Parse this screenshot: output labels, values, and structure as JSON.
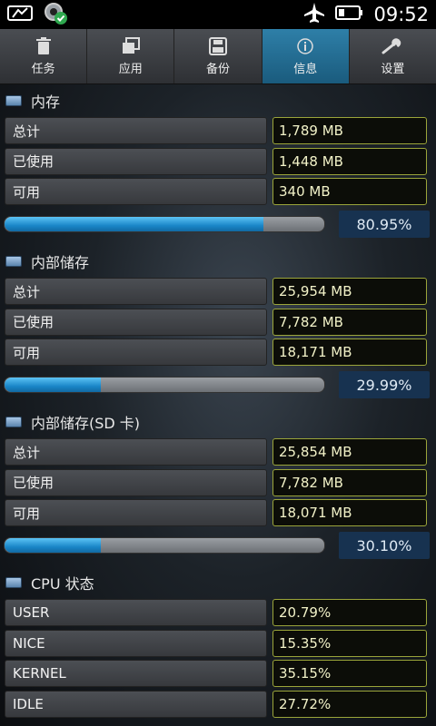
{
  "statusbar": {
    "time": "09:52",
    "icons": [
      "card-icon",
      "gear-check-icon",
      "airplane-icon",
      "battery-icon"
    ]
  },
  "tabs": [
    {
      "label": "任务",
      "icon": "trash-icon",
      "active": false
    },
    {
      "label": "应用",
      "icon": "apps-icon",
      "active": false
    },
    {
      "label": "备份",
      "icon": "save-icon",
      "active": false
    },
    {
      "label": "信息",
      "icon": "info-icon",
      "active": true
    },
    {
      "label": "设置",
      "icon": "wrench-icon",
      "active": false
    }
  ],
  "sections": [
    {
      "title": "内存",
      "rows": [
        {
          "label": "总计",
          "value": "1,789 MB"
        },
        {
          "label": "已使用",
          "value": "1,448 MB"
        },
        {
          "label": "可用",
          "value": "340 MB"
        }
      ],
      "percent": "80.95%",
      "progress": 0.8095
    },
    {
      "title": "内部储存",
      "rows": [
        {
          "label": "总计",
          "value": "25,954 MB"
        },
        {
          "label": "已使用",
          "value": "7,782 MB"
        },
        {
          "label": "可用",
          "value": "18,171 MB"
        }
      ],
      "percent": "29.99%",
      "progress": 0.2999
    },
    {
      "title": "内部储存(SD 卡)",
      "rows": [
        {
          "label": "总计",
          "value": "25,854 MB"
        },
        {
          "label": "已使用",
          "value": "7,782 MB"
        },
        {
          "label": "可用",
          "value": "18,071 MB"
        }
      ],
      "percent": "30.10%",
      "progress": 0.301
    }
  ],
  "cpu": {
    "title": "CPU 状态",
    "rows": [
      {
        "label": "USER",
        "value": "20.79%"
      },
      {
        "label": "NICE",
        "value": "15.35%"
      },
      {
        "label": "KERNEL",
        "value": "35.15%"
      },
      {
        "label": "IDLE",
        "value": "27.72%"
      }
    ]
  },
  "colors": {
    "active_tab": "#2e7fa8",
    "value_border": "#9ba53a",
    "progress_fill": "#1a86c8",
    "percent_bg": "#173250"
  }
}
